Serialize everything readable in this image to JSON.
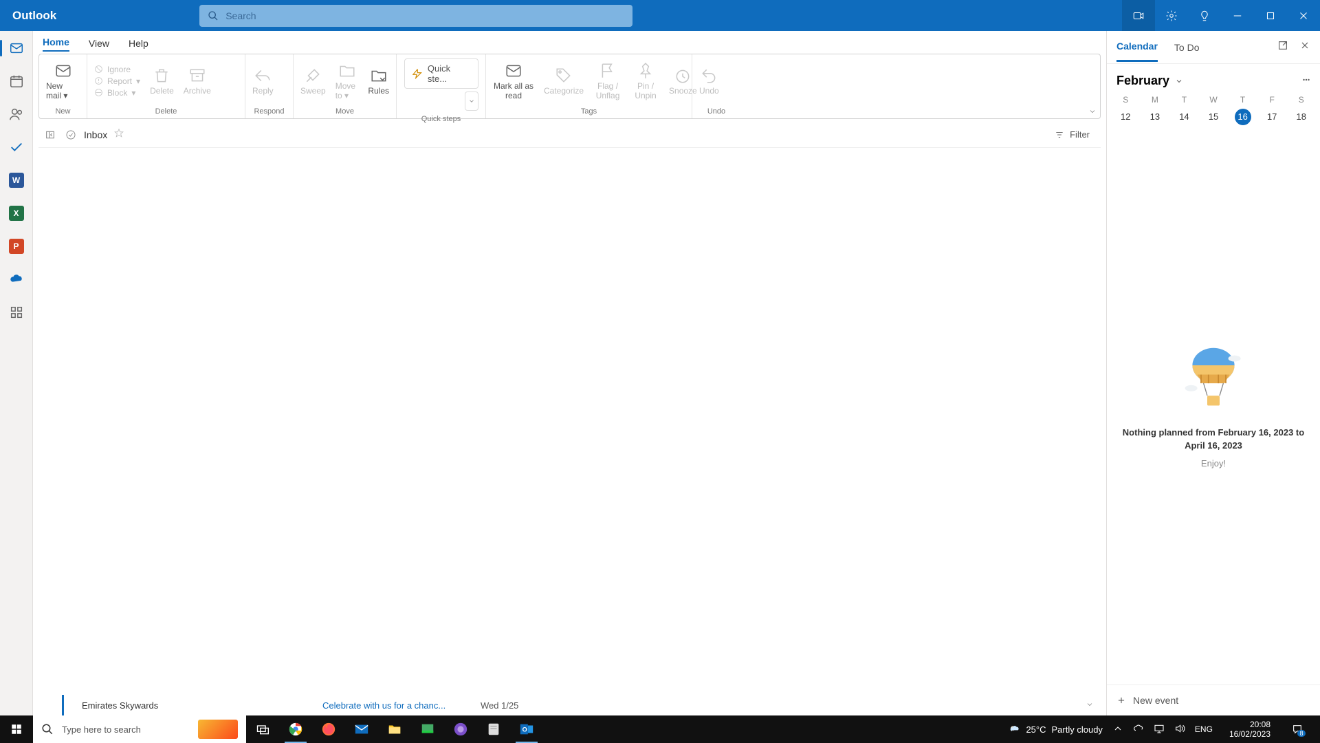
{
  "app": {
    "name": "Outlook"
  },
  "search": {
    "placeholder": "Search"
  },
  "tabs": {
    "home": "Home",
    "view": "View",
    "help": "Help"
  },
  "ribbon": {
    "newmail": "New mail",
    "ignore": "Ignore",
    "report": "Report",
    "block": "Block",
    "delete": "Delete",
    "archive": "Archive",
    "reply": "Reply",
    "sweep": "Sweep",
    "moveto": "Move to",
    "rules": "Rules",
    "quicksteps": "Quick ste...",
    "markread": "Mark all as read",
    "categorize": "Categorize",
    "flag": "Flag / Unflag",
    "pin": "Pin / Unpin",
    "snooze": "Snooze",
    "undo": "Undo",
    "grp_new": "New",
    "grp_delete": "Delete",
    "grp_respond": "Respond",
    "grp_move": "Move",
    "grp_quick": "Quick steps",
    "grp_tags": "Tags",
    "grp_undo": "Undo"
  },
  "inbox": {
    "name": "Inbox",
    "filter": "Filter"
  },
  "otherRow": {
    "from": "Emirates Skywards",
    "subject": "Celebrate with us for a chanc...",
    "date": "Wed 1/25"
  },
  "rpane": {
    "calTab": "Calendar",
    "todoTab": "To Do",
    "month": "February",
    "wd": [
      "S",
      "M",
      "T",
      "W",
      "T",
      "F",
      "S"
    ],
    "days": [
      "12",
      "13",
      "14",
      "15",
      "16",
      "17",
      "18"
    ],
    "todayIdx": 4,
    "nothing": "Nothing planned from February 16, 2023 to April 16, 2023",
    "enjoy": "Enjoy!",
    "newevent": "New event"
  },
  "taskbar": {
    "search": "Type here to search",
    "weatherTemp": "25°C",
    "weatherDesc": "Partly cloudy",
    "lang": "ENG",
    "time": "20:08",
    "date": "16/02/2023",
    "notif": "8"
  }
}
